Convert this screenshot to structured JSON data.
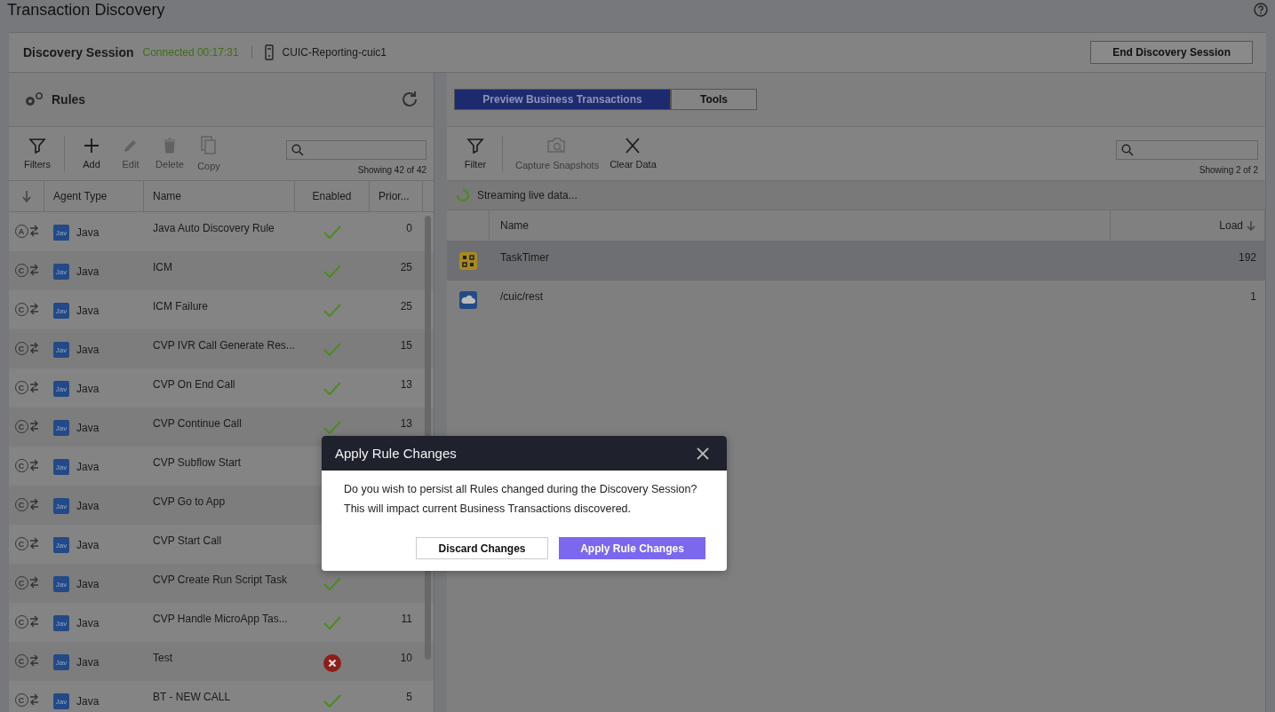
{
  "page_title": "Transaction Discovery",
  "session": {
    "label": "Discovery Session",
    "status": "Connected 00:17:31",
    "host": "CUIC-Reporting-cuic1",
    "end_button": "End Discovery Session"
  },
  "rules": {
    "title": "Rules",
    "toolbar": [
      {
        "kind": "filter",
        "label": "Filters",
        "disabled": false
      },
      {
        "kind": "add",
        "label": "Add",
        "disabled": false
      },
      {
        "kind": "edit",
        "label": "Edit",
        "disabled": true
      },
      {
        "kind": "delete",
        "label": "Delete",
        "disabled": true
      },
      {
        "kind": "copy",
        "label": "Copy",
        "disabled": true
      }
    ],
    "count": "Showing 42 of 42",
    "columns": [
      "Agent Type",
      "Name",
      "Enabled",
      "Prior..."
    ],
    "rows": [
      {
        "badge": "A",
        "agent_badge": "Jav",
        "agent": "Java",
        "name": "Java Auto Discovery Rule",
        "enabled": true,
        "priority": "0"
      },
      {
        "badge": "C",
        "agent_badge": "Jav",
        "agent": "Java",
        "name": "ICM",
        "enabled": true,
        "priority": "25"
      },
      {
        "badge": "C",
        "agent_badge": "Jav",
        "agent": "Java",
        "name": "ICM Failure",
        "enabled": true,
        "priority": "25"
      },
      {
        "badge": "C",
        "agent_badge": "Jav",
        "agent": "Java",
        "name": "CVP IVR Call Generate Res...",
        "enabled": true,
        "priority": "15"
      },
      {
        "badge": "C",
        "agent_badge": "Jav",
        "agent": "Java",
        "name": "CVP On End Call",
        "enabled": true,
        "priority": "13"
      },
      {
        "badge": "C",
        "agent_badge": "Jav",
        "agent": "Java",
        "name": "CVP Continue Call",
        "enabled": true,
        "priority": "13"
      },
      {
        "badge": "C",
        "agent_badge": "Jav",
        "agent": "Java",
        "name": "CVP Subflow Start"
      },
      {
        "badge": "C",
        "agent_badge": "Jav",
        "agent": "Java",
        "name": "CVP Go to App"
      },
      {
        "badge": "C",
        "agent_badge": "Jav",
        "agent": "Java",
        "name": "CVP Start Call"
      },
      {
        "badge": "C",
        "agent_badge": "Jav",
        "agent": "Java",
        "name": "CVP Create Run Script Task",
        "enabled": true
      },
      {
        "badge": "C",
        "agent_badge": "Jav",
        "agent": "Java",
        "name": "CVP Handle MicroApp Tas...",
        "enabled": true,
        "priority": "11"
      },
      {
        "badge": "C",
        "agent_badge": "Jav",
        "agent": "Java",
        "name": "Test",
        "enabled": false,
        "priority": "10"
      },
      {
        "badge": "C",
        "agent_badge": "Jav",
        "agent": "Java",
        "name": "BT - NEW CALL",
        "enabled": true,
        "priority": "5"
      }
    ]
  },
  "preview": {
    "tabs": [
      {
        "label": "Preview Business Transactions",
        "selected": true
      },
      {
        "label": "Tools",
        "selected": false
      }
    ],
    "toolbar": [
      {
        "kind": "filter",
        "label": "Filter",
        "disabled": false
      },
      {
        "kind": "snapshot",
        "label": "Capture Snapshots",
        "disabled": true
      },
      {
        "kind": "clear",
        "label": "Clear Data",
        "disabled": false
      }
    ],
    "count": "Showing 2 of 2",
    "streaming": "Streaming live data...",
    "columns": [
      "Name",
      "Load"
    ],
    "rows": [
      {
        "kind": "pojo",
        "name": "TaskTimer",
        "load": "192",
        "selected": true
      },
      {
        "kind": "web",
        "name": "/cuic/rest",
        "load": "1",
        "selected": false
      }
    ]
  },
  "dialog": {
    "title": "Apply Rule Changes",
    "lines": [
      "Do you wish to persist all Rules changed during the Discovery Session?",
      "This will impact current Business Transactions discovered."
    ],
    "buttons": [
      {
        "kind": "secondary",
        "label": "Discard Changes"
      },
      {
        "kind": "primary",
        "label": "Apply Rule Changes"
      }
    ]
  }
}
